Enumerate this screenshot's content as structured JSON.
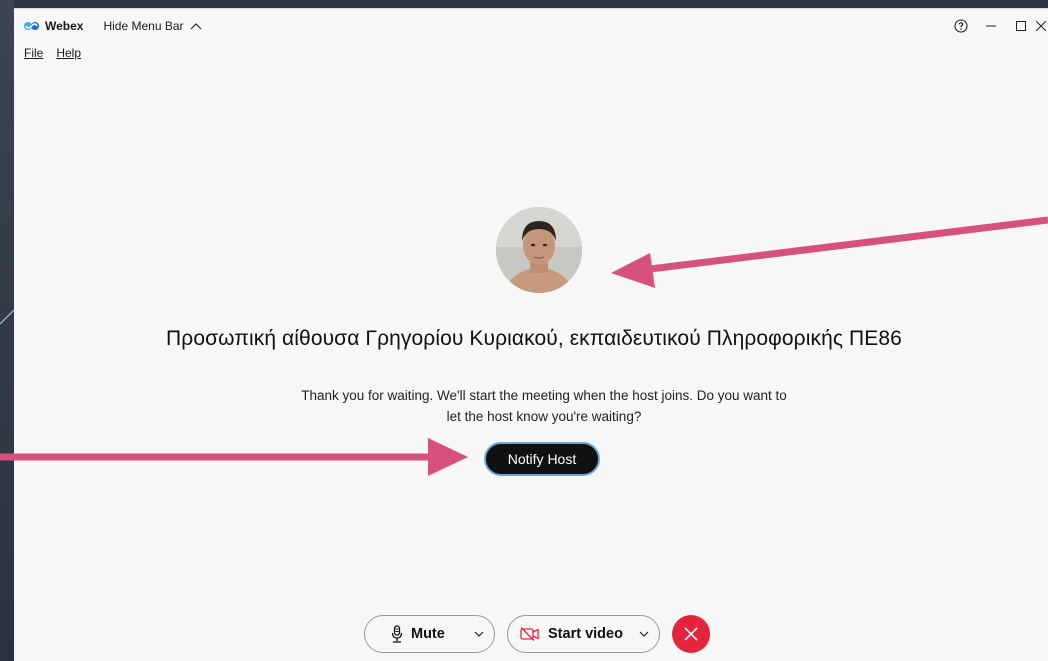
{
  "titlebar": {
    "app_name": "Webex",
    "hide_menu_label": "Hide Menu Bar"
  },
  "menu": {
    "file": "File",
    "help": "Help"
  },
  "meeting": {
    "title": "Προσωπική αίθουσα Γρηγορίου Κυριακού, εκπαιδευτικού Πληροφορικής ΠΕ86",
    "wait_message": "Thank you for waiting. We'll start the meeting when the host joins. Do you want to let the host know you're waiting?",
    "notify_button": "Notify Host"
  },
  "controls": {
    "mute_label": "Mute",
    "video_label": "Start video"
  },
  "colors": {
    "arrow": "#d6527c",
    "leave": "#e3243b",
    "notify_bg": "#111111",
    "notify_border": "#6fa3d8"
  },
  "icons": [
    "webex-logo-icon",
    "chevron-up-icon",
    "help-icon",
    "minimize-icon",
    "maximize-icon",
    "close-icon",
    "microphone-icon",
    "chevron-down-icon",
    "video-off-icon",
    "leave-icon"
  ]
}
